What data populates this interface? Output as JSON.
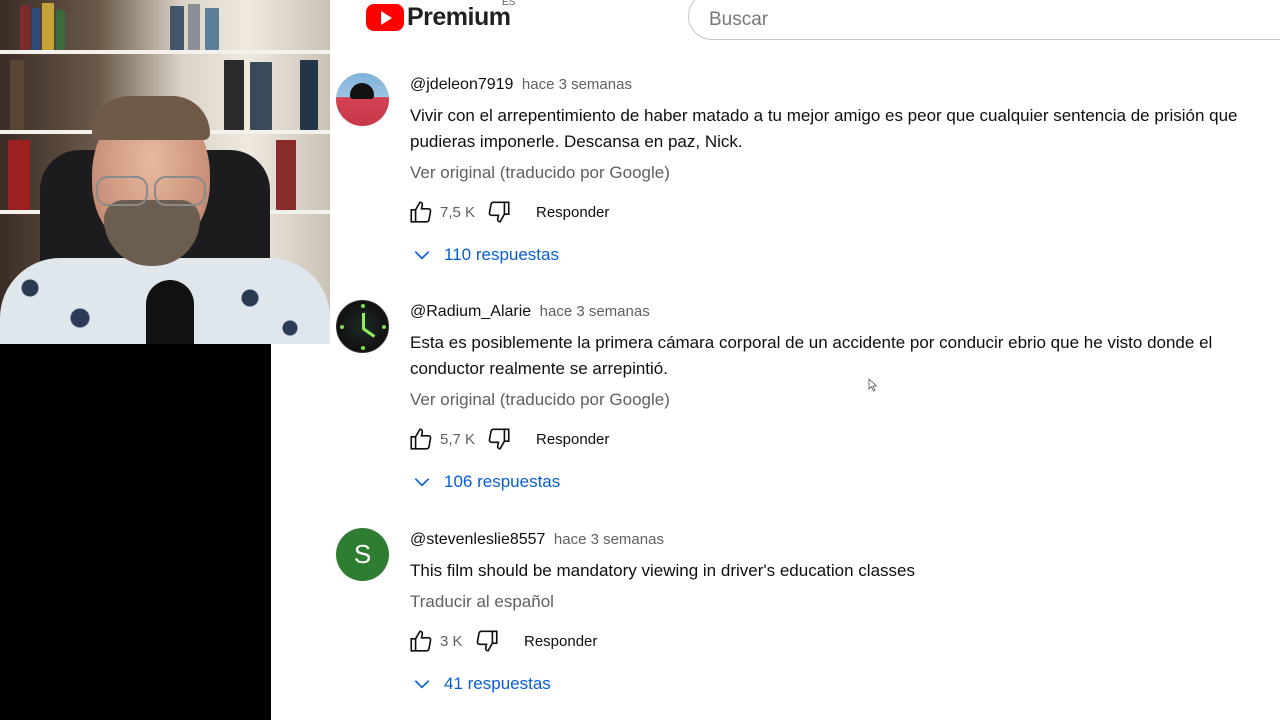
{
  "header": {
    "logo_text": "Premium",
    "country_code": "ES",
    "search_placeholder": "Buscar"
  },
  "comments": [
    {
      "author": "@jdeleon7919",
      "time": "hace 3 semanas",
      "text": "Vivir con el arrepentimiento de haber matado a tu mejor amigo es peor que cualquier sentencia de prisión que pudieras imponerle. Descansa en paz, Nick.",
      "translate_label": "Ver original (traducido por Google)",
      "likes": "7,5 K",
      "reply_label": "Responder",
      "replies_label": "110 respuestas"
    },
    {
      "author": "@Radium_Alarie",
      "time": "hace 3 semanas",
      "text": "Esta es posiblemente la primera cámara corporal de un accidente por conducir ebrio que he visto donde el conductor realmente se arrepintió.",
      "translate_label": "Ver original (traducido por Google)",
      "likes": "5,7 K",
      "reply_label": "Responder",
      "replies_label": "106 respuestas"
    },
    {
      "author": "@stevenleslie8557",
      "time": "hace 3 semanas",
      "avatar_letter": "S",
      "text": "This film should be mandatory viewing in driver's education classes",
      "translate_label": "Traducir al español",
      "likes": "3 K",
      "reply_label": "Responder",
      "replies_label": "41 respuestas"
    }
  ],
  "colors": {
    "brand_red": "#ff0000",
    "link_blue": "#065fd4",
    "secondary_text": "#606060",
    "avatar_green": "#2f7d32"
  },
  "icons": [
    "youtube-logo-icon",
    "like-icon",
    "dislike-icon",
    "chevron-down-icon",
    "mouse-cursor-icon"
  ]
}
